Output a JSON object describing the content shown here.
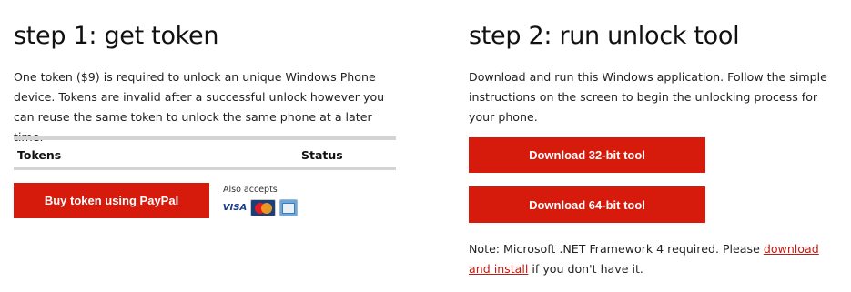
{
  "step1": {
    "title": "step 1: get token",
    "description": "One token ($9) is required to unlock an unique Windows Phone device. Tokens are invalid after a successful unlock however you can reuse the same token to unlock the same phone at a later time.",
    "table": {
      "headers": [
        "Tokens",
        "Status"
      ]
    },
    "buy_button": "Buy token using PayPal",
    "also_accepts": "Also accepts",
    "cards": [
      {
        "name": "visa",
        "label": "VISA",
        "icon": "visa-card-icon"
      },
      {
        "name": "mastercard",
        "icon": "mastercard-icon"
      },
      {
        "name": "amex",
        "icon": "amex-card-icon"
      }
    ]
  },
  "step2": {
    "title": "step 2: run unlock tool",
    "description": "Download and run this Windows application. Follow the simple instructions on the screen to begin the unlocking process for your phone.",
    "download_32": "Download 32-bit tool",
    "download_64": "Download 64-bit tool",
    "note_prefix": "Note: Microsoft .NET Framework 4 required. Please ",
    "note_link": "download and install",
    "note_suffix": " if you don't have it."
  },
  "colors": {
    "accent": "#d61a0c",
    "link": "#c01c14",
    "divider": "#d4d4d4"
  }
}
